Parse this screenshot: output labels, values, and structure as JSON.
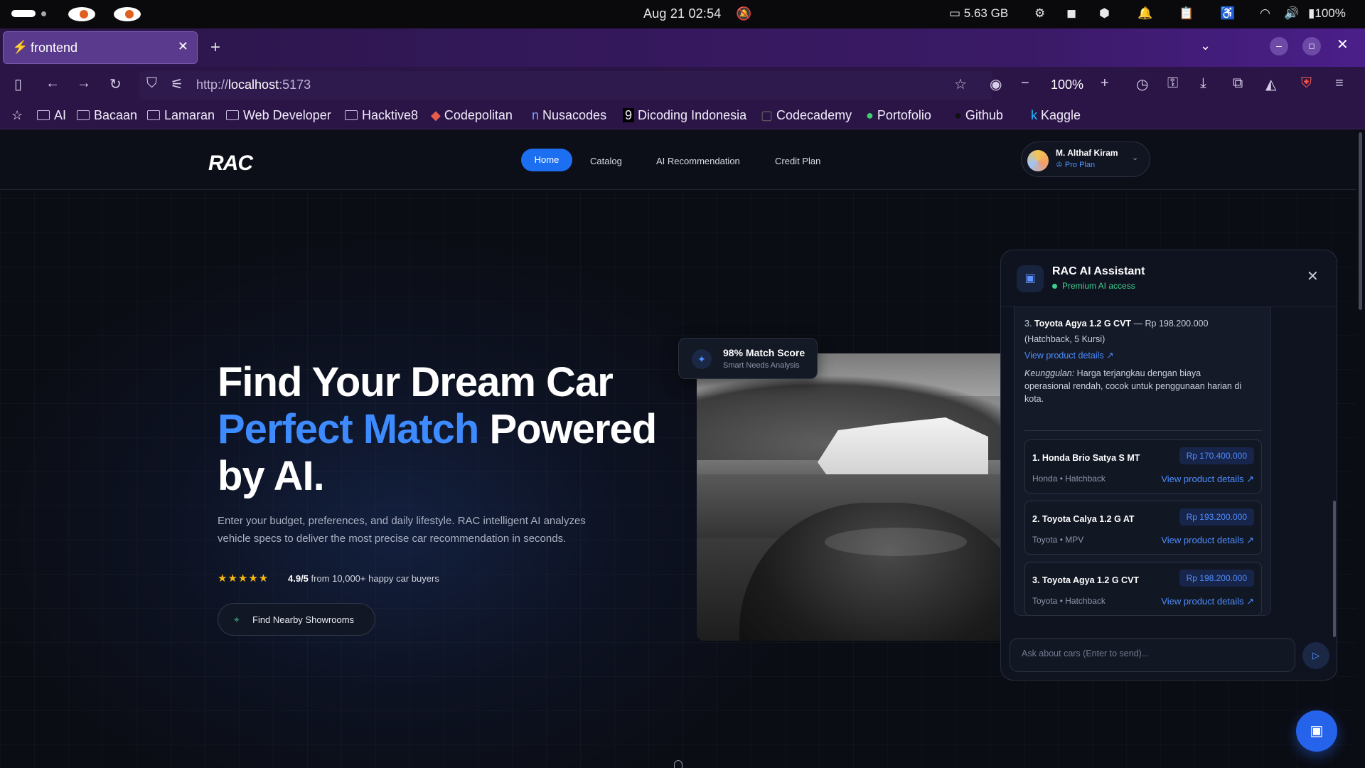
{
  "os": {
    "clock": "Aug 21  02:54",
    "memory": "5.63 GB",
    "battery": "100%"
  },
  "browser": {
    "tab_title": "frontend",
    "url_prefix": "http://",
    "url_host": "localhost",
    "url_port": ":5173",
    "zoom": "100%",
    "bookmarks": [
      "AI",
      "Bacaan",
      "Lamaran",
      "Web Developer",
      "Hacktive8",
      "Codepolitan",
      "Nusacodes",
      "Dicoding Indonesia",
      "Codecademy",
      "Portofolio",
      "Github",
      "Kaggle"
    ]
  },
  "site": {
    "logo": "RAC",
    "nav": [
      "Home",
      "Catalog",
      "AI Recommendation",
      "Credit Plan"
    ],
    "user_name": "M. Althaf Kiram",
    "user_plan": "Pro Plan"
  },
  "hero": {
    "line1": "Find Your Dream Car",
    "line2_accent": "Perfect Match",
    "line2_rest": " Powered",
    "line3": "by AI.",
    "subtitle": "Enter your budget, preferences, and daily lifestyle. RAC intelligent AI analyzes vehicle specs to deliver the most precise car recommendation in seconds.",
    "stars": "★★★★★",
    "rating_score": "4.9/5",
    "rating_text": " from 10,000+ happy car buyers",
    "showroom_button": "Find Nearby Showrooms",
    "match_title": "98% Match Score",
    "match_sub": "Smart Needs Analysis"
  },
  "chat": {
    "title": "RAC AI Assistant",
    "subtitle": "Premium AI access",
    "msg_item_prefix": "3. ",
    "msg_item_name": "Toyota Agya 1.2 G CVT",
    "msg_item_price": " — Rp 198.200.000",
    "msg_item_type": "(Hatchback, 5 Kursi)",
    "msg_link": "View product details",
    "msg_adv_label": "Keunggulan:",
    "msg_adv_text_1": " Harga terjangkau dengan biaya",
    "msg_adv_text_2": "operasional rendah, cocok untuk penggunaan harian di",
    "msg_adv_text_3": "kota.",
    "recommendations": [
      {
        "name": "1. Honda Brio Satya S MT",
        "price": "Rp 170.400.000",
        "meta": "Honda • Hatchback",
        "link": "View product details"
      },
      {
        "name": "2. Toyota Calya 1.2 G AT",
        "price": "Rp 193.200.000",
        "meta": "Toyota • MPV",
        "link": "View product details"
      },
      {
        "name": "3. Toyota Agya 1.2 G CVT",
        "price": "Rp 198.200.000",
        "meta": "Toyota • Hatchback",
        "link": "View product details"
      }
    ],
    "input_placeholder": "Ask about cars (Enter to send)..."
  }
}
